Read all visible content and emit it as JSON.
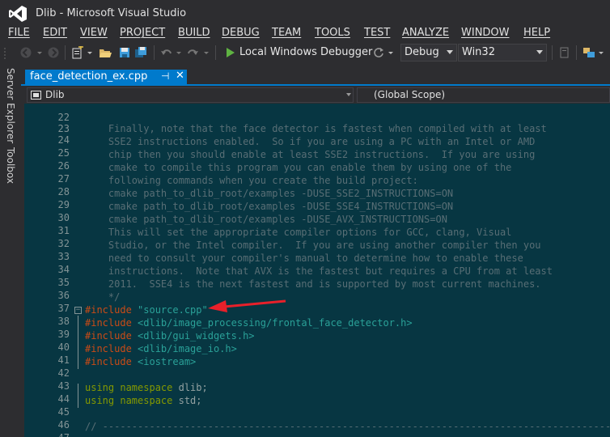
{
  "window": {
    "title": "Dlib - Microsoft Visual Studio"
  },
  "menu": {
    "items": [
      {
        "label": "FILE"
      },
      {
        "label": "EDIT"
      },
      {
        "label": "VIEW"
      },
      {
        "label": "PROJECT"
      },
      {
        "label": "BUILD"
      },
      {
        "label": "DEBUG"
      },
      {
        "label": "TEAM"
      },
      {
        "label": "TOOLS"
      },
      {
        "label": "TEST"
      },
      {
        "label": "ANALYZE"
      },
      {
        "label": "WINDOW"
      },
      {
        "label": "HELP"
      }
    ]
  },
  "toolbar": {
    "start_label": "Local Windows Debugger",
    "config_value": "Debug",
    "platform_value": "Win32"
  },
  "side": {
    "server_explorer": "Server Explorer",
    "toolbox": "Toolbox"
  },
  "tab": {
    "filename": "face_detection_ex.cpp",
    "pin": "⊣",
    "close": "✕"
  },
  "nav": {
    "project": "Dlib",
    "scope": "(Global Scope)"
  },
  "colors": {
    "accent": "#007acc",
    "editor_bg": "#073642",
    "annotation_arrow": "#e8202a"
  },
  "code": {
    "lines": [
      {
        "num": "22",
        "text": ""
      },
      {
        "num": "23",
        "text": ""
      },
      {
        "num": "24",
        "text": "    Finally, note that the face detector is fastest when compiled with at least"
      },
      {
        "num": "25",
        "text": "    SSE2 instructions enabled.  So if you are using a PC with an Intel or AMD"
      },
      {
        "num": "26",
        "text": "    chip then you should enable at least SSE2 instructions.  If you are using"
      },
      {
        "num": "27",
        "text": "    cmake to compile this program you can enable them by using one of the"
      },
      {
        "num": "28",
        "text": "    following commands when you create the build project:"
      },
      {
        "num": "29",
        "text": "    cmake path_to_dlib_root/examples -DUSE_SSE2_INSTRUCTIONS=ON"
      },
      {
        "num": "30",
        "text": "    cmake path_to_dlib_root/examples -DUSE_SSE4_INSTRUCTIONS=ON"
      },
      {
        "num": "31",
        "text": "    cmake path_to_dlib_root/examples -DUSE_AVX_INSTRUCTIONS=ON"
      },
      {
        "num": "32",
        "text": "    This will set the appropriate compiler options for GCC, clang, Visual"
      },
      {
        "num": "33",
        "text": "    Studio, or the Intel compiler.  If you are using another compiler then you"
      },
      {
        "num": "34",
        "text": "    need to consult your compiler's manual to determine how to enable these"
      },
      {
        "num": "35",
        "text": "    instructions.  Note that AVX is the fastest but requires a CPU from at least"
      },
      {
        "num": "36",
        "text": "    2011.  SSE4 is the next fastest and is supported by most current machines."
      },
      {
        "num": "37",
        "text": "    */"
      },
      {
        "num": "38",
        "directive": "#include",
        "arg": "\"source.cpp\""
      },
      {
        "num": "39",
        "directive": "#include",
        "arg": "<dlib/image_processing/frontal_face_detector.h>"
      },
      {
        "num": "40",
        "directive": "#include",
        "arg": "<dlib/gui_widgets.h>"
      },
      {
        "num": "41",
        "directive": "#include",
        "arg": "<dlib/image_io.h>"
      },
      {
        "num": "42",
        "directive": "#include",
        "arg": "<iostream>"
      },
      {
        "num": "43",
        "text": ""
      },
      {
        "num": "44",
        "kw": "using namespace",
        "rest": " dlib;"
      },
      {
        "num": "45",
        "kw": "using namespace",
        "rest": " std;"
      },
      {
        "num": "46",
        "text": ""
      },
      {
        "num": "47",
        "text": ""
      },
      {
        "num": "48",
        "text": "// ----------------------------------------------------------------------------------------"
      }
    ]
  }
}
